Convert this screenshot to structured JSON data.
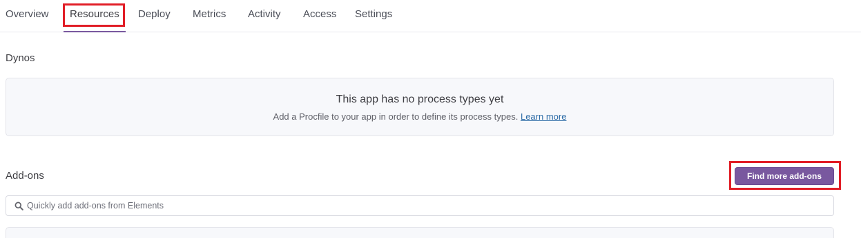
{
  "tabs": [
    {
      "label": "Overview"
    },
    {
      "label": "Resources"
    },
    {
      "label": "Deploy"
    },
    {
      "label": "Metrics"
    },
    {
      "label": "Activity"
    },
    {
      "label": "Access"
    },
    {
      "label": "Settings"
    }
  ],
  "active_tab": "Resources",
  "dynos": {
    "title": "Dynos",
    "empty_title": "This app has no process types yet",
    "empty_desc": "Add a Procfile to your app in order to define its process types.",
    "learn_more": "Learn more"
  },
  "addons": {
    "title": "Add-ons",
    "find_button": "Find more add-ons",
    "search_placeholder": "Quickly add add-ons from Elements",
    "search_value": ""
  },
  "colors": {
    "accent": "#79589f",
    "highlight": "#e11d26",
    "link": "#2d6ca7"
  }
}
